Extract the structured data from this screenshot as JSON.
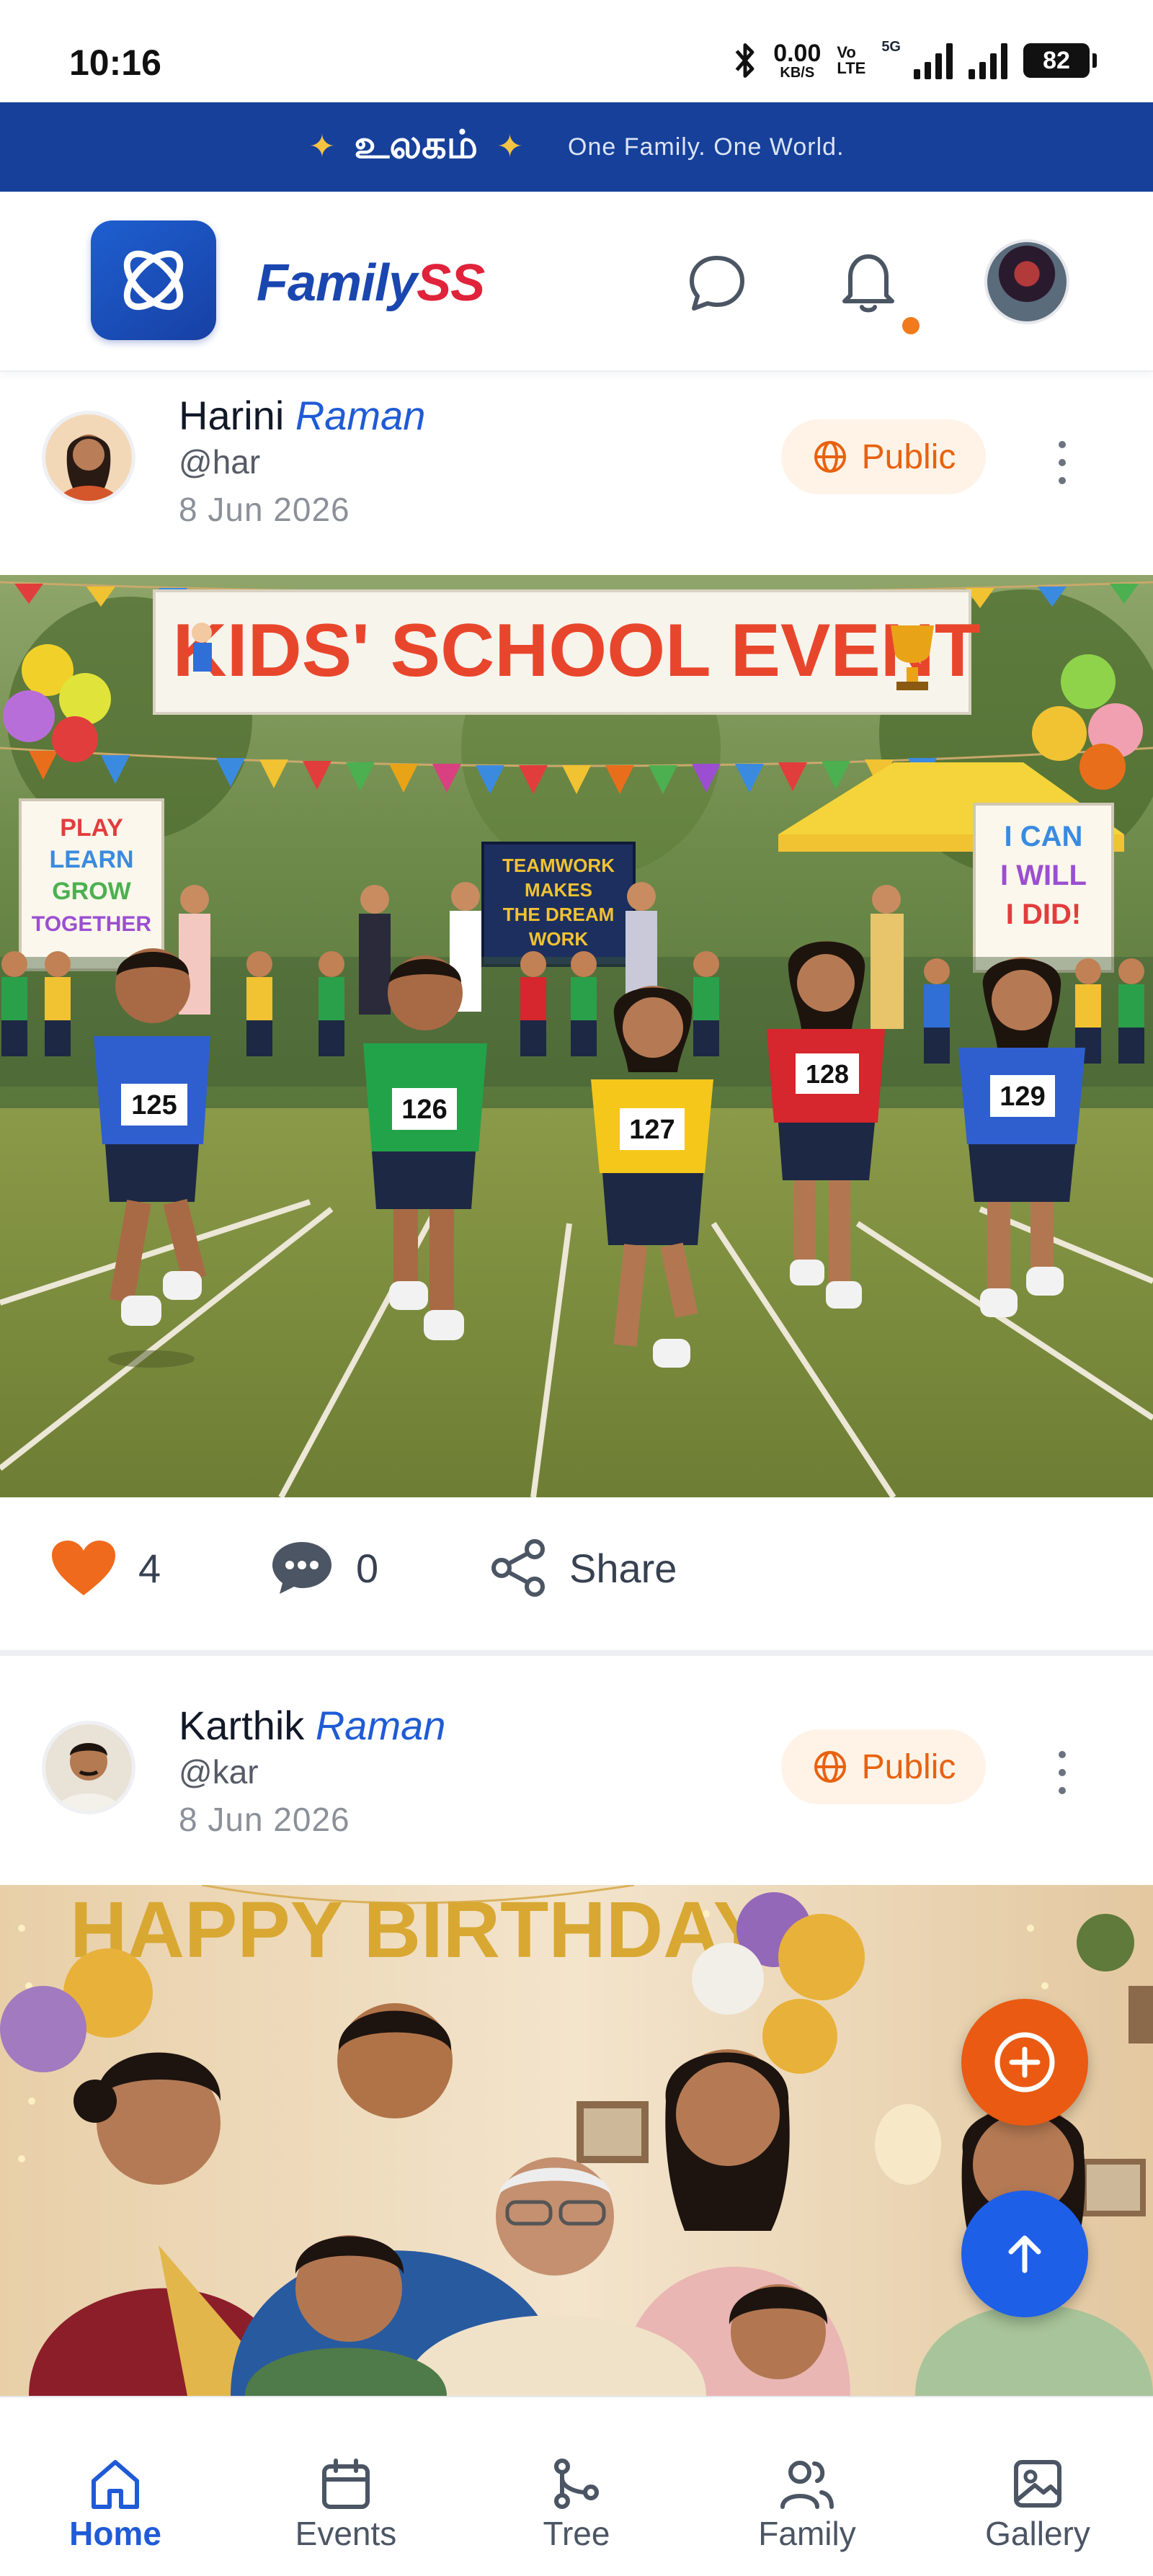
{
  "status_bar": {
    "time": "10:16",
    "net_speed": "0.00",
    "net_unit": "KB/S",
    "volte_1": "Vo",
    "volte_2": "LTE",
    "network": "5G",
    "battery": "82"
  },
  "banner": {
    "title": "உலகம்",
    "tagline": "One Family. One World."
  },
  "header": {
    "brand_first": "Family",
    "brand_second": "SS",
    "icons": [
      "chat-icon",
      "bell-icon"
    ],
    "notification_dot_color": "#f07a1c"
  },
  "posts": [
    {
      "first_name": "Harini",
      "last_name": "Raman",
      "handle": "@har",
      "date": "8 Jun 2026",
      "visibility": "Public",
      "image_banner_text": "KIDS' SCHOOL EVENT",
      "sign_left": [
        "PLAY",
        "LEARN",
        "GROW",
        "TOGETHER"
      ],
      "sign_center": [
        "TEAMWORK",
        "MAKES",
        "THE DREAM",
        "WORK"
      ],
      "sign_right": [
        "I CAN",
        "I WILL",
        "I DID!"
      ],
      "bibs": [
        "125",
        "126",
        "127",
        "128",
        "129"
      ],
      "likes": "4",
      "comments": "0",
      "share_label": "Share"
    },
    {
      "first_name": "Karthik",
      "last_name": "Raman",
      "handle": "@kar",
      "date": "8 Jun 2026",
      "visibility": "Public",
      "image_banner_text": "HAPPY BIRTHDAY"
    }
  ],
  "nav": {
    "items": [
      {
        "label": "Home",
        "icon": "home-icon"
      },
      {
        "label": "Events",
        "icon": "calendar-icon"
      },
      {
        "label": "Tree",
        "icon": "tree-icon"
      },
      {
        "label": "Family",
        "icon": "family-icon"
      },
      {
        "label": "Gallery",
        "icon": "gallery-icon"
      }
    ],
    "active": "Home"
  },
  "colors": {
    "brand_blue": "#16409a",
    "accent_orange": "#ea5a12",
    "fab_blue": "#1e5fe8",
    "link_blue": "#1f5bd6"
  }
}
